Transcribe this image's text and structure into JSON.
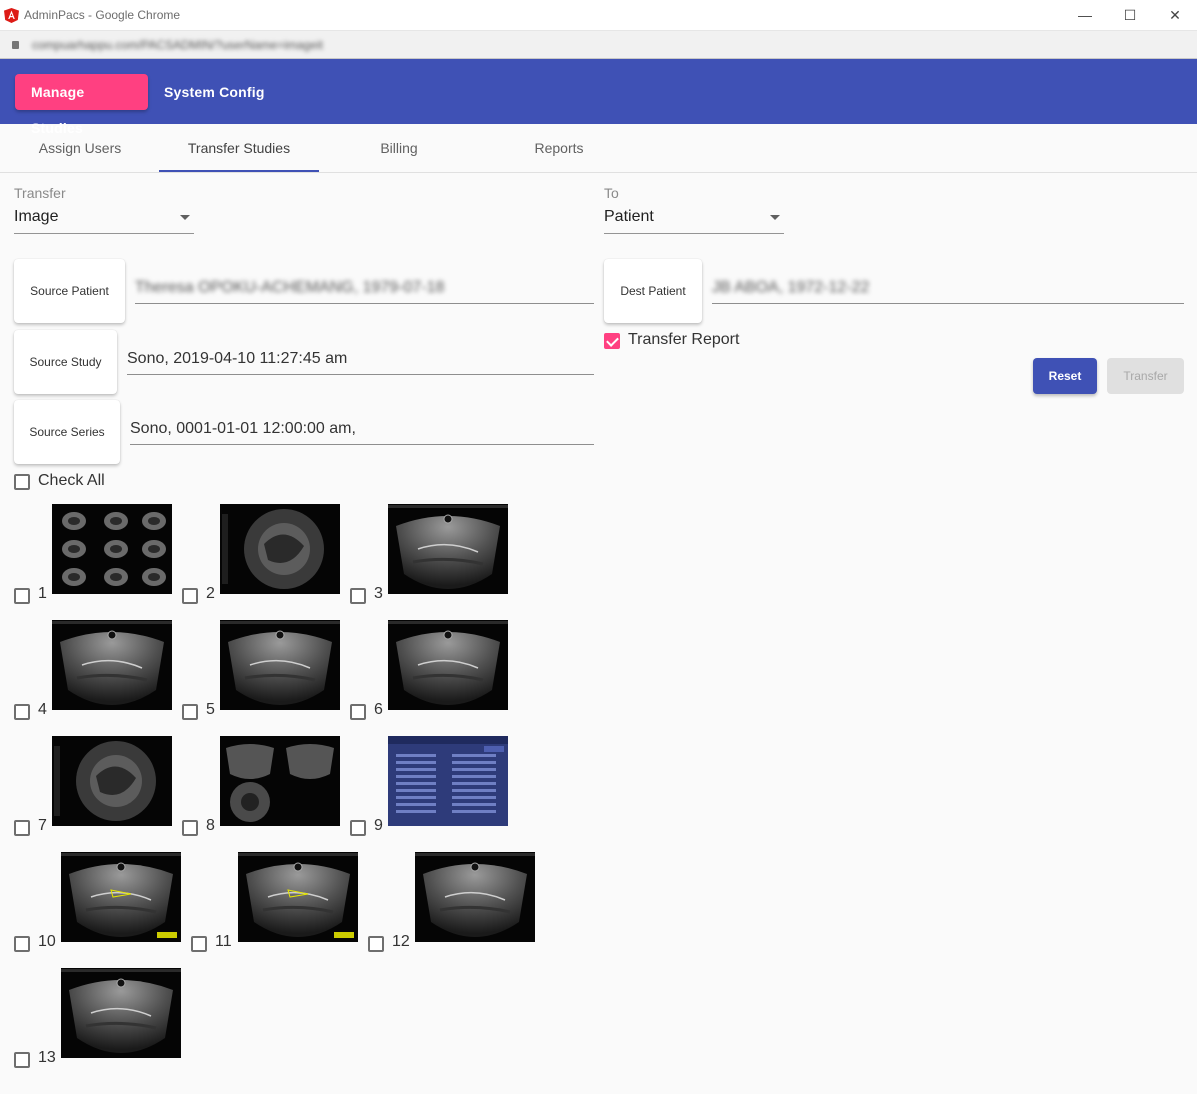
{
  "window": {
    "title": "AdminPacs - Google Chrome",
    "url": "compuarhappu.com/PACSADMIN/?userName=imageit"
  },
  "nav": {
    "manage_studies": "Manage Studies",
    "system_config": "System Config"
  },
  "tabs": [
    {
      "label": "Assign Users"
    },
    {
      "label": "Transfer Studies"
    },
    {
      "label": "Billing"
    },
    {
      "label": "Reports"
    }
  ],
  "transfer": {
    "label": "Transfer",
    "value": "Image"
  },
  "to": {
    "label": "To",
    "value": "Patient"
  },
  "source_patient": {
    "button": "Source Patient",
    "value": "Theresa OPOKU-ACHEMANG, 1979-07-18"
  },
  "source_study": {
    "button": "Source Study",
    "value": "Sono, 2019-04-10 11:27:45 am"
  },
  "source_series": {
    "button": "Source Series",
    "value": "Sono, 0001-01-01 12:00:00 am,"
  },
  "dest_patient": {
    "button": "Dest Patient",
    "value": "JB ABOA, 1972-12-22"
  },
  "transfer_report": {
    "label": "Transfer Report",
    "checked": true
  },
  "actions": {
    "reset": "Reset",
    "transfer": "Transfer"
  },
  "check_all": "Check All",
  "images": [
    {
      "number": "1",
      "kind": "grid"
    },
    {
      "number": "2",
      "kind": "round"
    },
    {
      "number": "3",
      "kind": "fan"
    },
    {
      "number": "4",
      "kind": "fan"
    },
    {
      "number": "5",
      "kind": "fan"
    },
    {
      "number": "6",
      "kind": "fan"
    },
    {
      "number": "7",
      "kind": "round"
    },
    {
      "number": "8",
      "kind": "multi"
    },
    {
      "number": "9",
      "kind": "report"
    },
    {
      "number": "10",
      "kind": "fan-marked"
    },
    {
      "number": "11",
      "kind": "fan-marked"
    },
    {
      "number": "12",
      "kind": "fan"
    },
    {
      "number": "13",
      "kind": "fan"
    }
  ]
}
